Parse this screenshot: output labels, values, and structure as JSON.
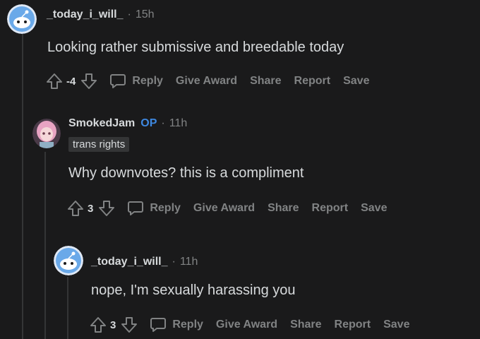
{
  "comments": [
    {
      "username": "_today_i_will_",
      "op": "",
      "time": "15h",
      "flair": "",
      "body": "Looking rather submissive and breedable today",
      "votes": "-4"
    },
    {
      "username": "SmokedJam",
      "op": "OP",
      "time": "11h",
      "flair": "trans rights",
      "body": "Why downvotes? this is a compliment",
      "votes": "3"
    },
    {
      "username": "_today_i_will_",
      "op": "",
      "time": "11h",
      "flair": "",
      "body": "nope, I'm sexually harassing you",
      "votes": "3"
    }
  ],
  "actions": {
    "reply": "Reply",
    "give_award": "Give Award",
    "share": "Share",
    "report": "Report",
    "save": "Save"
  },
  "separator": "·",
  "colors": {
    "background": "#1a1a1b",
    "text": "#d7dadc",
    "muted": "#818384",
    "op": "#3e88e0",
    "thread_line": "#343536"
  }
}
